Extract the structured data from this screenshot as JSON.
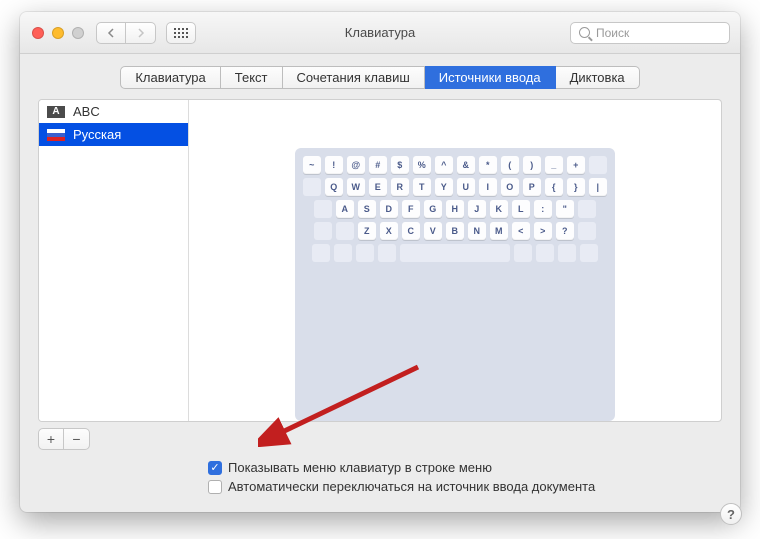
{
  "window": {
    "title": "Клавиатура"
  },
  "search": {
    "placeholder": "Поиск"
  },
  "tabs": {
    "keyboard": "Клавиатура",
    "text": "Текст",
    "shortcuts": "Сочетания клавиш",
    "inputsources": "Источники ввода",
    "dictation": "Диктовка",
    "selected": "inputsources"
  },
  "sources": {
    "items": [
      {
        "icon": "A",
        "label": "ABC"
      },
      {
        "icon": "ru",
        "label": "Русская"
      }
    ],
    "selected_index": 1
  },
  "keyboard_preview": {
    "row1": [
      "~",
      "!",
      "@",
      "#",
      "$",
      "%",
      "^",
      "&",
      "*",
      "(",
      ")",
      "_",
      "+"
    ],
    "row2": [
      "Q",
      "W",
      "E",
      "R",
      "T",
      "Y",
      "U",
      "I",
      "O",
      "P",
      "{",
      "}",
      "|"
    ],
    "row3": [
      "A",
      "S",
      "D",
      "F",
      "G",
      "H",
      "J",
      "K",
      "L",
      ":",
      "\""
    ],
    "row4": [
      "Z",
      "X",
      "C",
      "V",
      "B",
      "N",
      "M",
      "<",
      ">",
      "?"
    ]
  },
  "footer_buttons": {
    "add": "+",
    "remove": "−"
  },
  "options": {
    "show_menu": {
      "checked": true,
      "label": "Показывать меню клавиатур в строке меню"
    },
    "auto_switch": {
      "checked": false,
      "label": "Автоматически переключаться на источник ввода документа"
    }
  },
  "help": "?"
}
